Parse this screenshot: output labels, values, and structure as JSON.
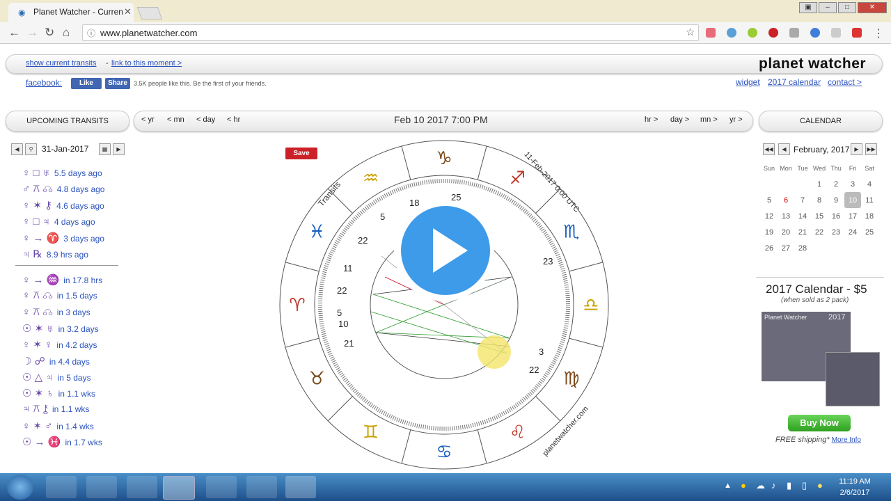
{
  "browser": {
    "tab_title": "Planet Watcher - Curren",
    "url": "www.planetwatcher.com"
  },
  "header": {
    "show_transits": "show current transits",
    "separator": "-",
    "link_moment": "link to this moment >",
    "logo": "planet watcher",
    "facebook": "facebook:",
    "like": "Like",
    "share": "Share",
    "fb_text": "3.5K people like this. Be the first of your friends.",
    "widget": "widget",
    "calendar_link": "2017 calendar",
    "contact": "contact >"
  },
  "nav": {
    "upcoming": "UPCOMING TRANSITS",
    "calendar": "CALENDAR",
    "yr_back": "< yr",
    "mn_back": "< mn",
    "day_back": "< day",
    "hr_back": "< hr",
    "datetime": "Feb 10 2017 7:00 PM",
    "hr_fwd": "hr >",
    "day_fwd": "day >",
    "mn_fwd": "mn >",
    "yr_fwd": "yr >"
  },
  "transit_date": "31-Jan-2017",
  "past_transits": [
    {
      "symbols": "♀ □ ♅",
      "text": "5.5 days ago"
    },
    {
      "symbols": "♂ ⚻ ☊",
      "text": "4.8 days ago"
    },
    {
      "symbols": "♀ ✶ ⚷",
      "text": "4.6 days ago"
    },
    {
      "symbols": "♀ □ ♃",
      "text": "4 days ago"
    },
    {
      "symbols": "♀ → ♈",
      "text": "3 days ago"
    },
    {
      "symbols": "♃ ℞",
      "text": "8.9 hrs ago"
    }
  ],
  "future_transits": [
    {
      "symbols": "♀ → ♒",
      "text": "in 17.8 hrs"
    },
    {
      "symbols": "♀ ⚻ ☊",
      "text": "in 1.5 days"
    },
    {
      "symbols": "♀ ⚻ ☊",
      "text": "in 3 days"
    },
    {
      "symbols": "☉ ✶ ♅",
      "text": "in 3.2 days"
    },
    {
      "symbols": "♀ ✶ ♀",
      "text": "in 4.2 days"
    },
    {
      "symbols": "☽ ☍",
      "text": "in 4.4 days"
    },
    {
      "symbols": "☉ △ ♃",
      "text": "in 5 days"
    },
    {
      "symbols": "☉ ✶ ♄",
      "text": "in 1.1 wks"
    },
    {
      "symbols": "♃ ⚻ ⚷",
      "text": "in 1.1 wks"
    },
    {
      "symbols": "♀ ✶ ♂",
      "text": "in 1.4 wks"
    },
    {
      "symbols": "☉ → ♓",
      "text": "in 1.7 wks"
    }
  ],
  "chart": {
    "save": "Save",
    "transits_label": "Transits",
    "date_label": "11-Feb-2017 0:00 UTC",
    "site_label": "planetwatcher.com",
    "zodiac": [
      "♑",
      "♒",
      "♓",
      "♈",
      "♉",
      "♊",
      "♋",
      "♌",
      "♍",
      "♎",
      "♏",
      "♐"
    ],
    "numbers": [
      "18",
      "25",
      "5",
      "22",
      "11",
      "22",
      "5",
      "10",
      "21",
      "23",
      "3",
      "22"
    ]
  },
  "calendar": {
    "month": "February, 2017",
    "weekdays": [
      "Sun",
      "Mon",
      "Tue",
      "Wed",
      "Thu",
      "Fri",
      "Sat"
    ],
    "weeks": [
      [
        "",
        "",
        "",
        "1",
        "2",
        "3",
        "4"
      ],
      [
        "5",
        "6",
        "7",
        "8",
        "9",
        "10",
        "11"
      ],
      [
        "12",
        "13",
        "14",
        "15",
        "16",
        "17",
        "18"
      ],
      [
        "19",
        "20",
        "21",
        "22",
        "23",
        "24",
        "25"
      ],
      [
        "26",
        "27",
        "28",
        "",
        "",
        "",
        ""
      ]
    ]
  },
  "promo": {
    "title": "2017 Calendar - $5",
    "subtitle": "(when sold as 2 pack)",
    "img_label": "Planet Watcher",
    "img_year": "2017",
    "buy": "Buy Now",
    "shipping": "FREE shipping*",
    "more": "More Info"
  },
  "taskbar": {
    "time": "11:19 AM",
    "date": "2/6/2017"
  }
}
